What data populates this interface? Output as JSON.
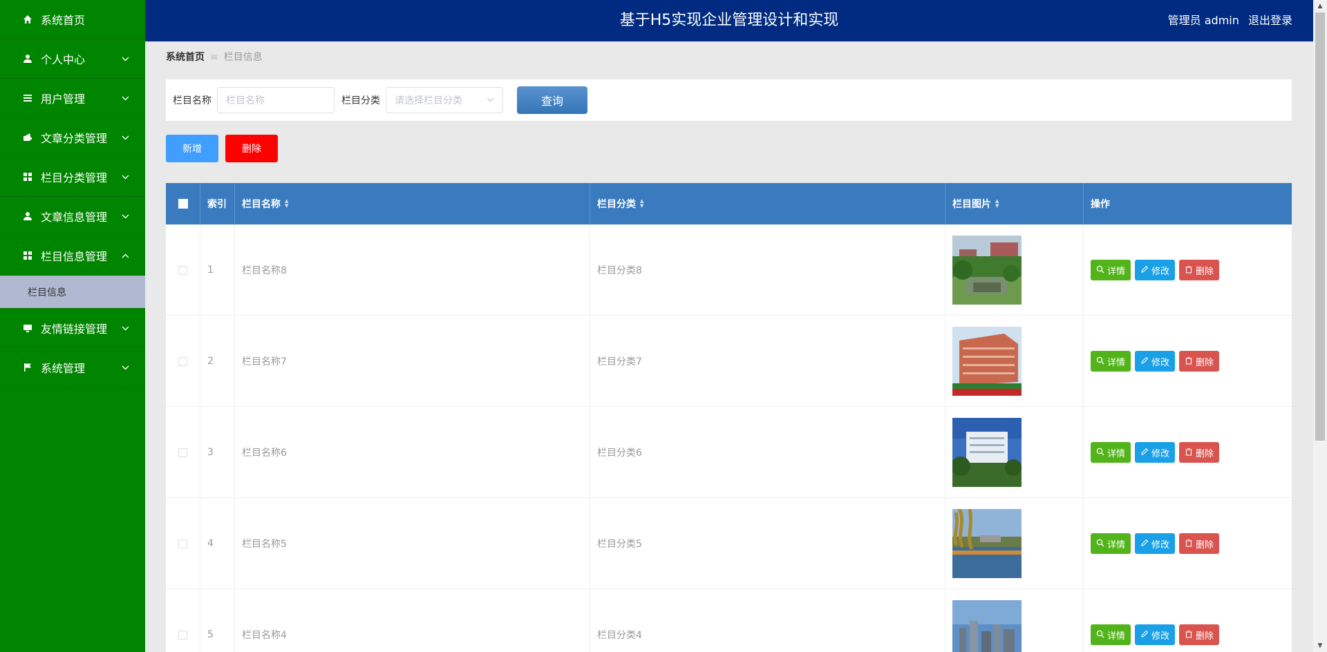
{
  "app": {
    "title": "基于H5实现企业管理设计和实现",
    "user_label": "管理员 admin",
    "logout_label": "退出登录"
  },
  "sidebar": {
    "items": [
      {
        "label": "系统首页",
        "icon": "home-icon",
        "chevron": false
      },
      {
        "label": "个人中心",
        "icon": "user-icon",
        "chevron": true
      },
      {
        "label": "用户管理",
        "icon": "list-icon",
        "chevron": true
      },
      {
        "label": "文章分类管理",
        "icon": "wallet-icon",
        "chevron": true
      },
      {
        "label": "栏目分类管理",
        "icon": "grid-icon",
        "chevron": true
      },
      {
        "label": "文章信息管理",
        "icon": "user-icon",
        "chevron": true
      },
      {
        "label": "栏目信息管理",
        "icon": "grid-icon",
        "chevron": true,
        "expanded": true,
        "submenu": [
          {
            "label": "栏目信息"
          }
        ]
      },
      {
        "label": "友情链接管理",
        "icon": "monitor-icon",
        "chevron": true
      },
      {
        "label": "系统管理",
        "icon": "flag-icon",
        "chevron": true
      }
    ]
  },
  "breadcrumb": {
    "home": "系统首页",
    "separator": "≡",
    "current": "栏目信息"
  },
  "search": {
    "name_label": "栏目名称",
    "name_placeholder": "栏目名称",
    "category_label": "栏目分类",
    "category_placeholder": "请选择栏目分类",
    "query_label": "查询"
  },
  "actions": {
    "add_label": "新增",
    "delete_label": "删除"
  },
  "table": {
    "columns": {
      "index": "索引",
      "name": "栏目名称",
      "category": "栏目分类",
      "image": "栏目图片",
      "operation": "操作"
    },
    "op_labels": {
      "detail": "详情",
      "edit": "修改",
      "remove": "删除"
    },
    "rows": [
      {
        "index": "1",
        "name": "栏目名称8",
        "category": "栏目分类8",
        "image_scene": "campus-garden"
      },
      {
        "index": "2",
        "name": "栏目名称7",
        "category": "栏目分类7",
        "image_scene": "red-building"
      },
      {
        "index": "3",
        "name": "栏目名称6",
        "category": "栏目分类6",
        "image_scene": "white-building"
      },
      {
        "index": "4",
        "name": "栏目名称5",
        "category": "栏目分类5",
        "image_scene": "lake-willow"
      },
      {
        "index": "5",
        "name": "栏目名称4",
        "category": "栏目分类4",
        "image_scene": "city-skyline"
      }
    ]
  },
  "colors": {
    "sidebar_bg": "#008500",
    "header_bg": "#002b80",
    "table_header_bg": "#3a7bbf",
    "add_button": "#409eff",
    "delete_button": "#ff0000",
    "detail_button": "#52b41a",
    "edit_button": "#1aa0e6",
    "remove_button": "#d9534f"
  }
}
